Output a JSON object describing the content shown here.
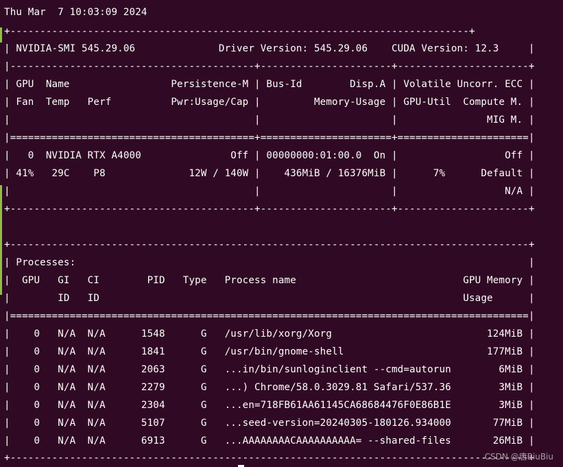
{
  "terminal": {
    "lines": [
      "Thu Mar  7 10:03:09 2024",
      "+-----------------------------------------------------------------------------+",
      "| NVIDIA-SMI 545.29.06              Driver Version: 545.29.06    CUDA Version: 12.3     |",
      "|-----------------------------------------+----------------------+----------------------+",
      "| GPU  Name                 Persistence-M | Bus-Id        Disp.A | Volatile Uncorr. ECC |",
      "| Fan  Temp   Perf          Pwr:Usage/Cap |         Memory-Usage | GPU-Util  Compute M. |",
      "|                                         |                      |               MIG M. |",
      "|=========================================+======================+======================|",
      "|   0  NVIDIA RTX A4000               Off | 00000000:01:00.0  On |                  Off |",
      "| 41%   29C    P8              12W / 140W |    436MiB / 16376MiB |      7%      Default |",
      "|                                         |                      |                  N/A |",
      "+-----------------------------------------+----------------------+----------------------+",
      "",
      "",
      "+---------------------------------------------------------------------------------------+",
      "| Processes:                                                                            |",
      "|  GPU   GI   CI        PID   Type   Process name                            GPU Memory |",
      "|        ID   ID                                                             Usage      |",
      "|=======================================================================================|",
      "|    0   N/A  N/A      1548      G   /usr/lib/xorg/Xorg                          124MiB |",
      "|    0   N/A  N/A      1841      G   /usr/bin/gnome-shell                        177MiB |",
      "|    0   N/A  N/A      2063      G   ...in/bin/sunloginclient --cmd=autorun        6MiB |",
      "|    0   N/A  N/A      2279      G   ...) Chrome/58.0.3029.81 Safari/537.36        3MiB |",
      "|    0   N/A  N/A      2304      G   ...en=718FB61AA61145CA68684476F0E86B1E        3MiB |",
      "|    0   N/A  N/A      5107      G   ...seed-version=20240305-180126.934000       77MiB |",
      "|    0   N/A  N/A      6913      G   ...AAAAAAAACAAAAAAAAAA= --shared-files       26MiB |",
      "+---------------------------------------------------------------------------------------+"
    ]
  },
  "watermark": "CSDN @唐BiuBiu",
  "colors": {
    "background": "#300a24",
    "text": "#ffffff",
    "watermark": "#b8a9b2"
  }
}
